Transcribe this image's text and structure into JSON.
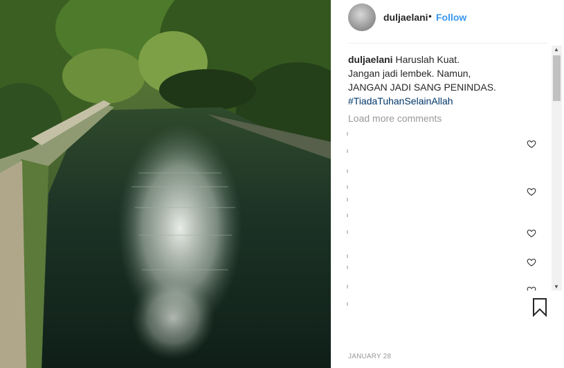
{
  "post": {
    "username": "duljaelani",
    "separator": "•",
    "follow_label": "Follow"
  },
  "caption": {
    "username": "duljaelani",
    "line1": "Haruslah Kuat.",
    "line2": "Jangan jadi lembek. Namun,",
    "line3": "JANGAN JADI SANG PENINDAS.",
    "hashtag": "#TiadaTuhanSelainAllah"
  },
  "comments": {
    "load_more_label": "Load more comments",
    "hearts": [
      {
        "icon": "heart-icon"
      },
      {
        "icon": "heart-icon"
      },
      {
        "icon": "heart-icon"
      },
      {
        "icon": "heart-icon"
      },
      {
        "icon": "heart-icon"
      }
    ]
  },
  "scrollbar": {
    "up_glyph": "▲",
    "down_glyph": "▼"
  },
  "footer": {
    "date": "JANUARY 28",
    "bookmark_icon": "bookmark-icon"
  },
  "colors": {
    "link_blue": "#3897f0",
    "hashtag_blue": "#003569",
    "text": "#262626",
    "muted": "#999999"
  }
}
